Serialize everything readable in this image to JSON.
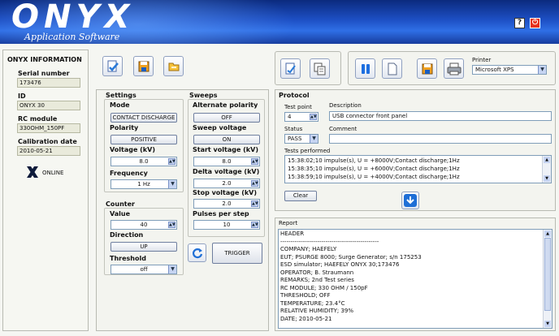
{
  "header": {
    "logo": "ONYX",
    "subtitle": "Application Software",
    "help_label": "?",
    "power_label": "⏻"
  },
  "info": {
    "title": "ONYX INFORMATION",
    "serial_label": "Serial number",
    "serial_value": "173476",
    "id_label": "ID",
    "id_value": "ONYX 30",
    "rc_label": "RC module",
    "rc_value": "330OHM_150PF",
    "cal_label": "Calibration date",
    "cal_value": "2010-05-21",
    "status": "ONLINE"
  },
  "settings": {
    "title": "Settings",
    "mode_label": "Mode",
    "mode_value": "CONTACT DISCHARGE",
    "polarity_label": "Polarity",
    "polarity_value": "POSITIVE",
    "voltage_label": "Voltage (kV)",
    "voltage_value": "8.0",
    "frequency_label": "Frequency",
    "frequency_value": "1 Hz"
  },
  "sweeps": {
    "title": "Sweeps",
    "alt_label": "Alternate polarity",
    "alt_value": "OFF",
    "sweep_label": "Sweep voltage",
    "sweep_value": "ON",
    "start_label": "Start voltage (kV)",
    "start_value": "8.0",
    "delta_label": "Delta voltage (kV)",
    "delta_value": "2.0",
    "stop_label": "Stop voltage (kV)",
    "stop_value": "2.0",
    "pulses_label": "Pulses per step",
    "pulses_value": "10"
  },
  "counter": {
    "title": "Counter",
    "value_label": "Value",
    "value": "40",
    "direction_label": "Direction",
    "direction_value": "UP",
    "threshold_label": "Threshold",
    "threshold_value": "off"
  },
  "trigger_label": "TRIGGER",
  "printer": {
    "label": "Printer",
    "value": "Microsoft XPS"
  },
  "protocol": {
    "title": "Protocol",
    "test_point_label": "Test point",
    "test_point_value": "4",
    "description_label": "Description",
    "description_value": "USB connector front panel",
    "status_label": "Status",
    "status_value": "PASS",
    "comment_label": "Comment",
    "comment_value": "",
    "tests_label": "Tests performed",
    "tests": [
      "15:38:02;10 impulse(s), U = +8000V;Contact discharge;1Hz",
      "15:38:35;10 impulse(s), U = +6000V;Contact discharge;1Hz",
      "15:38:59;10 impulse(s), U = +4000V;Contact discharge;1Hz"
    ],
    "clear_label": "Clear"
  },
  "report": {
    "title": "Report",
    "lines": [
      "HEADER",
      "------------------------------------------------",
      "COMPANY; HAEFELY",
      "EUT; PSURGE 8000; Surge Generator; s/n 175253",
      "ESD simulator; HAEFELY ONYX 30;173476",
      "OPERATOR; B. Straumann",
      "REMARKS; 2nd Test series",
      "RC MODULE; 330 OHM / 150pF",
      "THRESHOLD; OFF",
      "TEMPERATURE; 23.4°C",
      "RELATIVE HUMIDITY; 39%",
      "DATE; 2010-05-21"
    ]
  }
}
